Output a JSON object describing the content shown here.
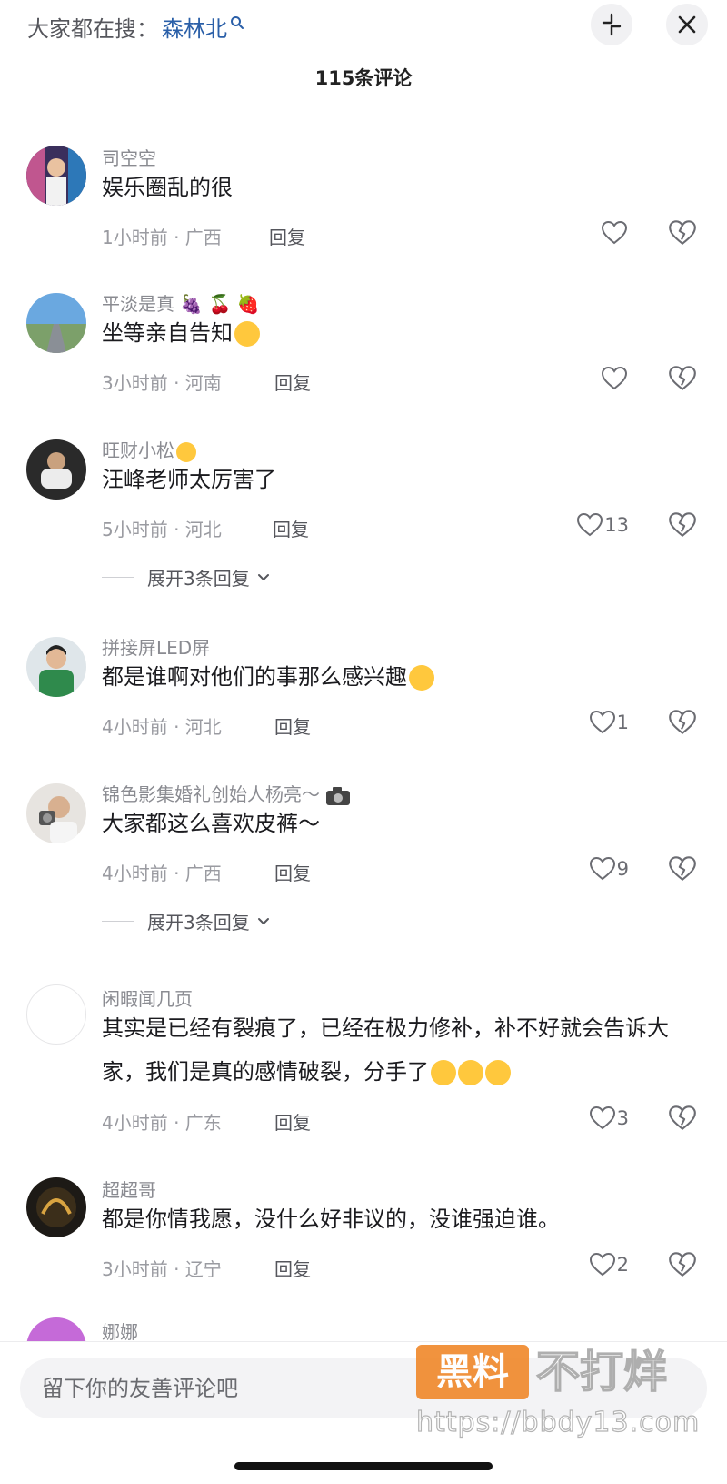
{
  "header": {
    "search_prefix": "大家都在搜：",
    "search_term": "森林北",
    "comment_count": "115条评论"
  },
  "comments": [
    {
      "user": "司空空",
      "text": "娱乐圈乱的很",
      "time_loc": "1小时前 · 广西",
      "reply": "回复",
      "likes": ""
    },
    {
      "user": "平淡是真",
      "user_suffix": "🍇 🍒 🍓",
      "text": "坐等亲自告知",
      "time_loc": "3小时前 · 河南",
      "reply": "回复",
      "likes": ""
    },
    {
      "user": "旺财小松",
      "text": "汪峰老师太厉害了",
      "time_loc": "5小时前 · 河北",
      "reply": "回复",
      "likes": "13",
      "expand": "展开3条回复"
    },
    {
      "user": "拼接屏LED屏",
      "text": "都是谁啊对他们的事那么感兴趣",
      "time_loc": "4小时前 · 河北",
      "reply": "回复",
      "likes": "1"
    },
    {
      "user": "锦色影集婚礼创始人杨亮～",
      "text": "大家都这么喜欢皮裤～",
      "time_loc": "4小时前 · 广西",
      "reply": "回复",
      "likes": "9",
      "expand": "展开3条回复"
    },
    {
      "user": "闲暇闻几页",
      "text": "其实是已经有裂痕了，已经在极力修补，补不好就会告诉大家，我们是真的感情破裂，分手了",
      "time_loc": "4小时前 · 广东",
      "reply": "回复",
      "likes": "3"
    },
    {
      "user": "超超哥",
      "text": "都是你情我愿，没什么好非议的，没谁强迫谁。",
      "time_loc": "3小时前 · 辽宁",
      "reply": "回复",
      "likes": "2"
    },
    {
      "user": "娜娜"
    }
  ],
  "input": {
    "placeholder": "留下你的友善评论吧"
  },
  "watermark": {
    "box": "黑料",
    "text": "不打烊",
    "url": "https://bbdy13.com"
  },
  "colors": {
    "search_term": "#2a5fa8",
    "watermark_orange": "#f08a2e",
    "meta": "#9a9ba1"
  },
  "icons": [
    "search-icon",
    "collapse-icon",
    "close-icon",
    "heart-icon",
    "broken-heart-icon",
    "chevron-down-icon"
  ]
}
